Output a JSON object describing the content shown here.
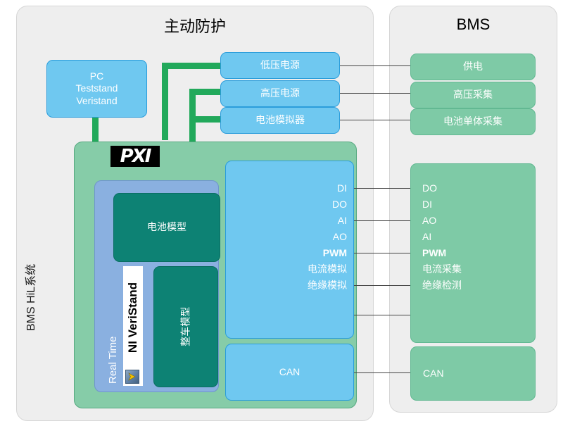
{
  "panels": {
    "left": {
      "title": "主动防护"
    },
    "right": {
      "title": "BMS"
    },
    "side_label": "BMS HiL系统"
  },
  "left_panel": {
    "pc_box": {
      "line1": "PC",
      "line2": "Teststand",
      "line3": "Veristand"
    },
    "supply_boxes": [
      {
        "label": "低压电源"
      },
      {
        "label": "高压电源"
      },
      {
        "label": "电池模拟器"
      }
    ],
    "pxi": {
      "logo": "PXI",
      "real_time_label": "Real Time",
      "ni_veristand_label": "NI VeriStand",
      "battery_model": "电池模型",
      "vehicle_model": "整车模型",
      "io_signals": [
        "DI",
        "DO",
        "AI",
        "AO",
        "PWM",
        "电流模拟",
        "绝缘模拟"
      ],
      "can_label": "CAN"
    }
  },
  "right_panel": {
    "top_boxes": [
      {
        "label": "供电"
      },
      {
        "label": "高压采集"
      },
      {
        "label": "电池单体采集"
      }
    ],
    "io_signals": [
      "DO",
      "DI",
      "AO",
      "AI",
      "PWM",
      "电流采集",
      "绝缘检测"
    ],
    "can_label": "CAN"
  },
  "colors": {
    "blue": "#6fc8f0",
    "green": "#7ecaa6",
    "teal": "#0d8274",
    "pxi_green": "#86cca8",
    "rt_blue": "#8ab0e0",
    "green_wire": "#22a95b",
    "panel_bg": "#eeeeee",
    "line": "#444444"
  }
}
